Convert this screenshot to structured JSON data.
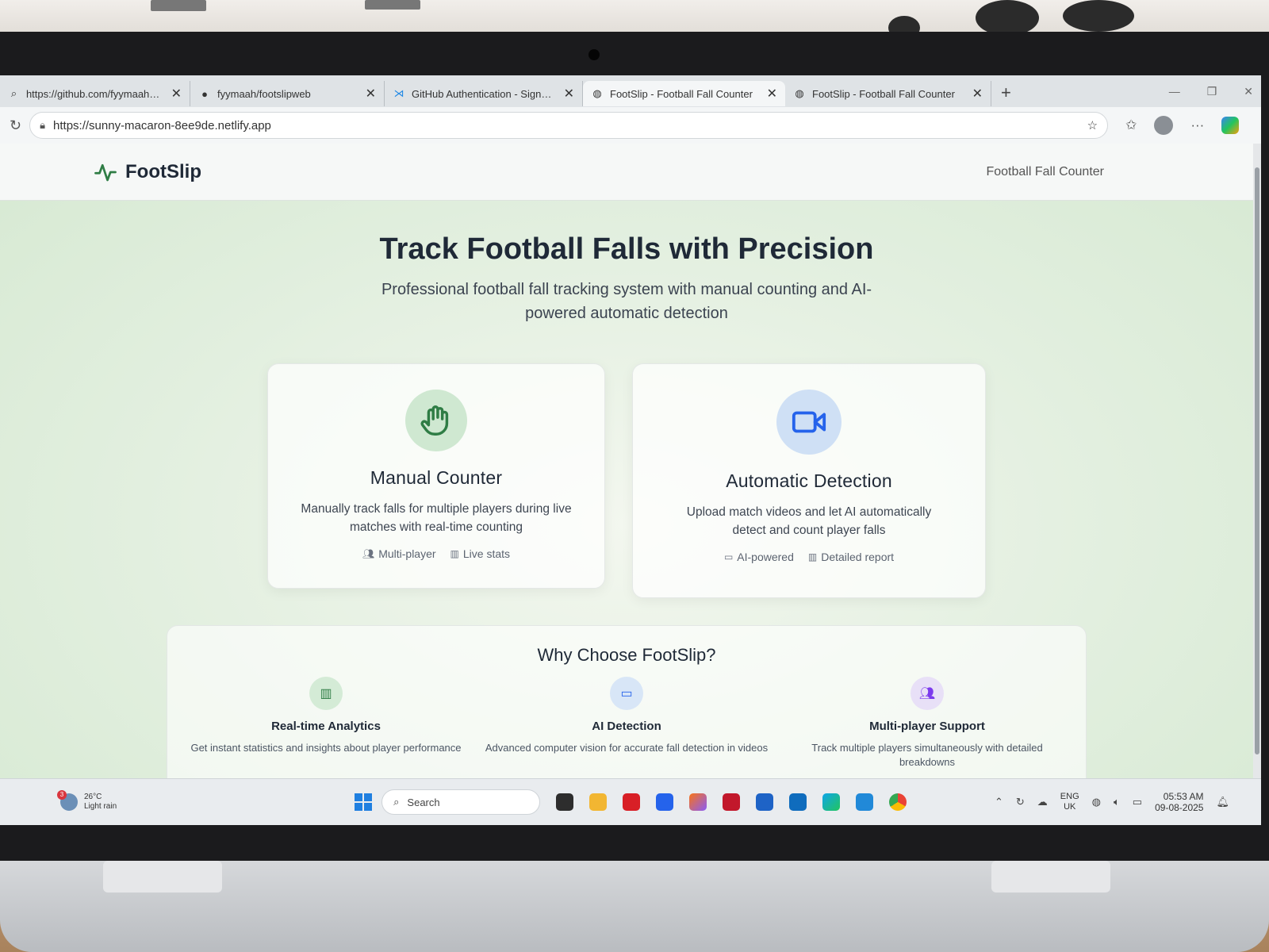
{
  "browser": {
    "tabs": [
      {
        "title": "https://github.com/fyymaah/foot",
        "icon": "search-icon",
        "active": false
      },
      {
        "title": "fyymaah/footslipweb",
        "icon": "github-icon",
        "active": false
      },
      {
        "title": "GitHub Authentication - Sign In",
        "icon": "vscode-icon",
        "active": false
      },
      {
        "title": "FootSlip - Football Fall Counter",
        "icon": "globe-icon",
        "active": true
      },
      {
        "title": "FootSlip - Football Fall Counter",
        "icon": "globe-icon",
        "active": false
      }
    ],
    "url": "https://sunny-macaron-8ee9de.netlify.app"
  },
  "header": {
    "logo_text": "FootSlip",
    "nav_link": "Football Fall Counter"
  },
  "hero": {
    "title": "Track Football Falls with Precision",
    "subtitle": "Professional football fall tracking system with manual counting and AI-powered automatic detection"
  },
  "cards": [
    {
      "title": "Manual Counter",
      "description": "Manually track falls for multiple players during live matches with real-time counting",
      "icon": "hand-icon",
      "tags": [
        "Multi-player",
        "Live stats"
      ]
    },
    {
      "title": "Automatic Detection",
      "description": "Upload match videos and let AI automatically detect and count player falls",
      "icon": "video-camera-icon",
      "tags": [
        "AI-powered",
        "Detailed report"
      ]
    }
  ],
  "why": {
    "title": "Why Choose FootSlip?",
    "features": [
      {
        "title": "Real-time Analytics",
        "description": "Get instant statistics and insights about player performance",
        "icon": "bar-chart-icon"
      },
      {
        "title": "AI Detection",
        "description": "Advanced computer vision for accurate fall detection in videos",
        "icon": "video-camera-icon"
      },
      {
        "title": "Multi-player Support",
        "description": "Track multiple players simultaneously with detailed breakdowns",
        "icon": "users-icon"
      }
    ]
  },
  "taskbar": {
    "weather_temp": "26°C",
    "weather_desc": "Light rain",
    "weather_badge": "3",
    "search_placeholder": "Search",
    "lang_1": "ENG",
    "lang_2": "UK",
    "time": "05:53 AM",
    "date": "09-08-2025"
  }
}
